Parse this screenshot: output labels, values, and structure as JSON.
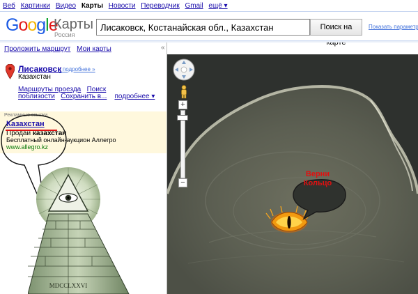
{
  "topnav": {
    "items": [
      "Веб",
      "Картинки",
      "Видео",
      "Карты",
      "Новости",
      "Переводчик",
      "Gmail",
      "ещё ▾"
    ],
    "selected_index": 3
  },
  "header": {
    "logo_text": "Google",
    "product": "Карты",
    "region": "Россия",
    "search_value": "Лисаковск, Костанайская обл., Казахстан",
    "search_button": "Поиск на карте",
    "params_link": "Показать параметры п"
  },
  "left_panel": {
    "top_links": [
      "Проложить маршрут",
      "Мои карты"
    ],
    "collapse_label": "«",
    "place": {
      "name": "Лисаковск",
      "more": "- подробнее »",
      "country": "Казахстан"
    },
    "actions": {
      "row1": [
        "Маршруты проезда",
        "Поиск"
      ],
      "row2": [
        "поблизости",
        "Сохранить в...",
        "подробнее ▾"
      ]
    },
    "ad": {
      "label": "Рекламные ссылки",
      "title": "Казахстан",
      "line1_prefix": "Продай ",
      "line1_bold": "казахстан",
      "line2": "Бесплатный онлайн-аукцион Аллегро",
      "url": "www.allegro.kz"
    },
    "pyramid_inscription": "MDCCLXXVI"
  },
  "map": {
    "bubble_text_line1": "Верни",
    "bubble_text_line2": "Кольцо",
    "zoom_plus": "+",
    "zoom_minus": "−"
  },
  "colors": {
    "link": "#1a0dab",
    "ad_bg": "#fff8dd",
    "bubble_text": "#e01010",
    "map_dark": "#2c2f2b"
  }
}
